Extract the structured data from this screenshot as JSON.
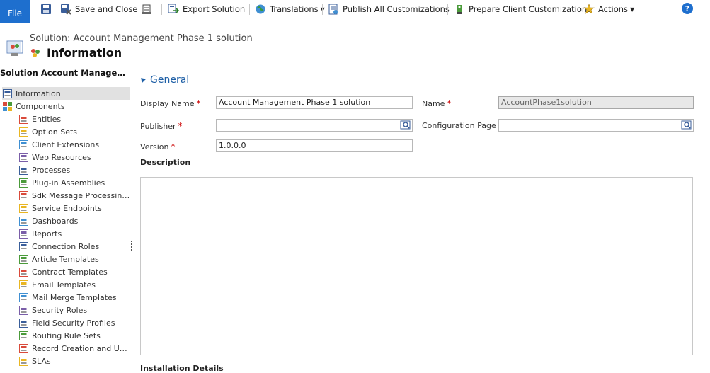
{
  "toolbar": {
    "file_label": "File",
    "save_close_label": "Save and Close",
    "export_label": "Export Solution",
    "translations_label": "Translations",
    "publish_label": "Publish All Customizations",
    "prepare_label": "Prepare Client Customizations",
    "actions_label": "Actions",
    "help_glyph": "?"
  },
  "header": {
    "breadcrumb": "Solution: Account Management Phase 1 solution",
    "title": "Information"
  },
  "nav": {
    "title": "Solution Account Management Ph...",
    "items": [
      {
        "label": "Information",
        "icon": "information-icon",
        "selected": true,
        "level": 0
      },
      {
        "label": "Components",
        "icon": "components-icon",
        "level": 0
      },
      {
        "label": "Entities",
        "icon": "entities-icon",
        "level": 1
      },
      {
        "label": "Option Sets",
        "icon": "option-sets-icon",
        "level": 1
      },
      {
        "label": "Client Extensions",
        "icon": "client-extensions-icon",
        "level": 1
      },
      {
        "label": "Web Resources",
        "icon": "web-resources-icon",
        "level": 1
      },
      {
        "label": "Processes",
        "icon": "processes-icon",
        "level": 1
      },
      {
        "label": "Plug-in Assemblies",
        "icon": "plugin-assemblies-icon",
        "level": 1
      },
      {
        "label": "Sdk Message Processing St...",
        "icon": "sdk-message-icon",
        "level": 1
      },
      {
        "label": "Service Endpoints",
        "icon": "service-endpoints-icon",
        "level": 1
      },
      {
        "label": "Dashboards",
        "icon": "dashboards-icon",
        "level": 1
      },
      {
        "label": "Reports",
        "icon": "reports-icon",
        "level": 1
      },
      {
        "label": "Connection Roles",
        "icon": "connection-roles-icon",
        "level": 1
      },
      {
        "label": "Article Templates",
        "icon": "article-templates-icon",
        "level": 1
      },
      {
        "label": "Contract Templates",
        "icon": "contract-templates-icon",
        "level": 1
      },
      {
        "label": "Email Templates",
        "icon": "email-templates-icon",
        "level": 1
      },
      {
        "label": "Mail Merge Templates",
        "icon": "mail-merge-templates-icon",
        "level": 1
      },
      {
        "label": "Security Roles",
        "icon": "security-roles-icon",
        "level": 1
      },
      {
        "label": "Field Security Profiles",
        "icon": "field-security-icon",
        "level": 1
      },
      {
        "label": "Routing Rule Sets",
        "icon": "routing-rules-icon",
        "level": 1
      },
      {
        "label": "Record Creation and Updat...",
        "icon": "record-creation-icon",
        "level": 1
      },
      {
        "label": "SLAs",
        "icon": "slas-icon",
        "level": 1
      }
    ]
  },
  "form": {
    "section_title": "General",
    "display_name_label": "Display Name",
    "display_name_value": "Account Management Phase 1 solution",
    "name_label": "Name",
    "name_value": "AccountPhase1solution",
    "publisher_label": "Publisher",
    "publisher_value": "",
    "config_page_label": "Configuration Page",
    "config_page_value": "",
    "version_label": "Version",
    "version_value": "1.0.0.0",
    "required_marker": "*",
    "description_label": "Description",
    "description_value": "",
    "installation_label": "Installation Details"
  },
  "colors": {
    "file_button": "#1e6fce",
    "section_header": "#1e5fa6",
    "required": "#cc0000",
    "nav_selected": "#e1e1e1"
  }
}
